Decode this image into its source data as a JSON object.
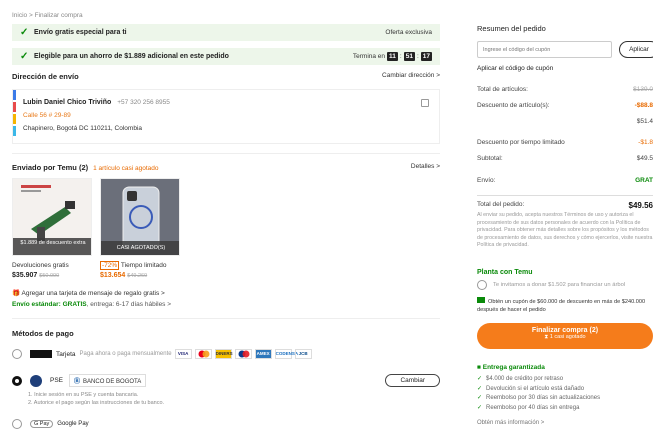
{
  "breadcrumb": {
    "home": "Inicio",
    "sep": ">",
    "current": "Finalizar compra"
  },
  "banners": [
    {
      "text": "Envío gratis especial para ti",
      "right": "Oferta exclusiva"
    },
    {
      "text": "Elegible para un ahorro de $1.889 adicional en este pedido",
      "right_label": "Termina en",
      "timer": [
        "11",
        "51",
        "17"
      ]
    }
  ],
  "shipping_address": {
    "title": "Dirección de envío",
    "change_link": "Cambiar dirección >",
    "name": "Lubin Daniel Chico Triviño",
    "phone": "+57 320 256 8955",
    "street": "Calle 56 # 29-89",
    "city": "Chapinero, Bogotá DC 110211, Colombia"
  },
  "shipped_by": {
    "title": "Enviado por Temu (2)",
    "note": "1 artículo casi agotado",
    "details_link": "Detalles >",
    "products": [
      {
        "overlay": "$1.889 de descuento extra",
        "tag": "Devoluciones gratis",
        "price": "$35.907",
        "old_price": "$50.000"
      },
      {
        "overlay": "CASI AGOTADO(S)",
        "discount": "-72%",
        "tag": "Tiempo limitado",
        "price": "$13.654",
        "old_price": "$49.269"
      }
    ],
    "gift_card_link": "Agregar una tarjeta de mensaje de regalo gratis >",
    "shipping_standard": "Envío estándar: GRATIS",
    "shipping_eta": ", entrega: 6-17 días hábiles >"
  },
  "payment": {
    "title": "Métodos de pago",
    "card_method": {
      "label": "Tarjeta",
      "sub": "Paga ahora o paga mensualmente"
    },
    "card_brands": [
      "VISA",
      "MC",
      "DINERS",
      "MC",
      "AMEX",
      "CODENSA",
      "JCB"
    ],
    "pse": {
      "label": "PSE",
      "bank": "BANCO DE BOGOTA",
      "change_button": "Cambiar"
    },
    "pse_steps": [
      "1. Inicie sesión en su PSE y cuenta bancaria.",
      "2. Autorice el pago según las instrucciones de tu banco."
    ],
    "gpay": {
      "badge": "G Pay",
      "label": "Google Pay"
    }
  },
  "summary": {
    "title": "Resumen del pedido",
    "coupon_placeholder": "Ingrese el código del cupón",
    "apply_button": "Aplicar",
    "apply_code_link": "Aplicar el código de cupón",
    "rows": [
      {
        "label": "Total de artículos:",
        "value": "$139.0"
      },
      {
        "label": "Descuento de artículo(s):",
        "value": "-$88.8"
      },
      {
        "label": "",
        "value": "$51.4"
      },
      {
        "label": "Descuento por tiempo limitado",
        "value": "-$1.8"
      },
      {
        "label": "Subtotal:",
        "value": "$49.5"
      },
      {
        "label": "Envío:",
        "value": "GRAT"
      }
    ],
    "total_label": "Total del pedido:",
    "total_value": "$49.56",
    "legal_text": "Al enviar su pedido, acepta nuestros Términos de uso y autoriza el procesamiento de sus datos personales de acuerdo con la Política de privacidad. Para obtener más detalles sobre los propósitos y los métodos de procesamiento de datos, sus derechos y cómo ejercerlos, visite nuestra Política de privacidad.",
    "plant_title": "Planta con Temu",
    "plant_text": "Te invitamos a donar $1.502 para financiar un árbol",
    "coupon_offer": "Obtén un cupón de $60.000 de descuento en más de $240.000 después de hacer el pedido",
    "order_button": "Finalizar compra (2)",
    "order_button_sub": "1 casi agotado",
    "guarantee_title": "Entrega garantizada",
    "guarantees": [
      "$4.000 de crédito por retraso",
      "Devolución si el artículo está dañado",
      "Reembolso por 30 días sin actualizaciones",
      "Reembolso por 40 días sin entrega"
    ],
    "more_info": "Obtén más información >"
  },
  "colors": {
    "accent": "#f57c1b",
    "green": "#0a8a0a",
    "banner_bg": "#edf6ea"
  }
}
